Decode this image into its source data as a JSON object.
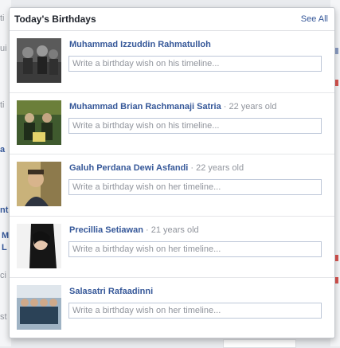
{
  "background": {
    "fragments": [
      "ti",
      "ui",
      "ti",
      "a",
      "nt",
      "M",
      "L",
      "ci",
      "st"
    ]
  },
  "popup": {
    "title": "Today's Birthdays",
    "see_all": "See All",
    "people": [
      {
        "name": "Muhammad Izzuddin Rahmatulloh",
        "age": "",
        "placeholder": "Write a birthday wish on his timeline..."
      },
      {
        "name": "Muhammad Brian Rachmanaji Satria",
        "age": " · 22 years old",
        "placeholder": "Write a birthday wish on his timeline..."
      },
      {
        "name": "Galuh Perdana Dewi Asfandi",
        "age": " · 22 years old",
        "placeholder": "Write a birthday wish on her timeline..."
      },
      {
        "name": "Precillia Setiawan",
        "age": " · 21 years old",
        "placeholder": "Write a birthday wish on her timeline..."
      },
      {
        "name": "Salasatri Rafaadinni",
        "age": "",
        "placeholder": "Write a birthday wish on her timeline..."
      }
    ]
  },
  "colors": {
    "link": "#365899",
    "muted": "#90949c",
    "border": "#bdc7d8"
  }
}
